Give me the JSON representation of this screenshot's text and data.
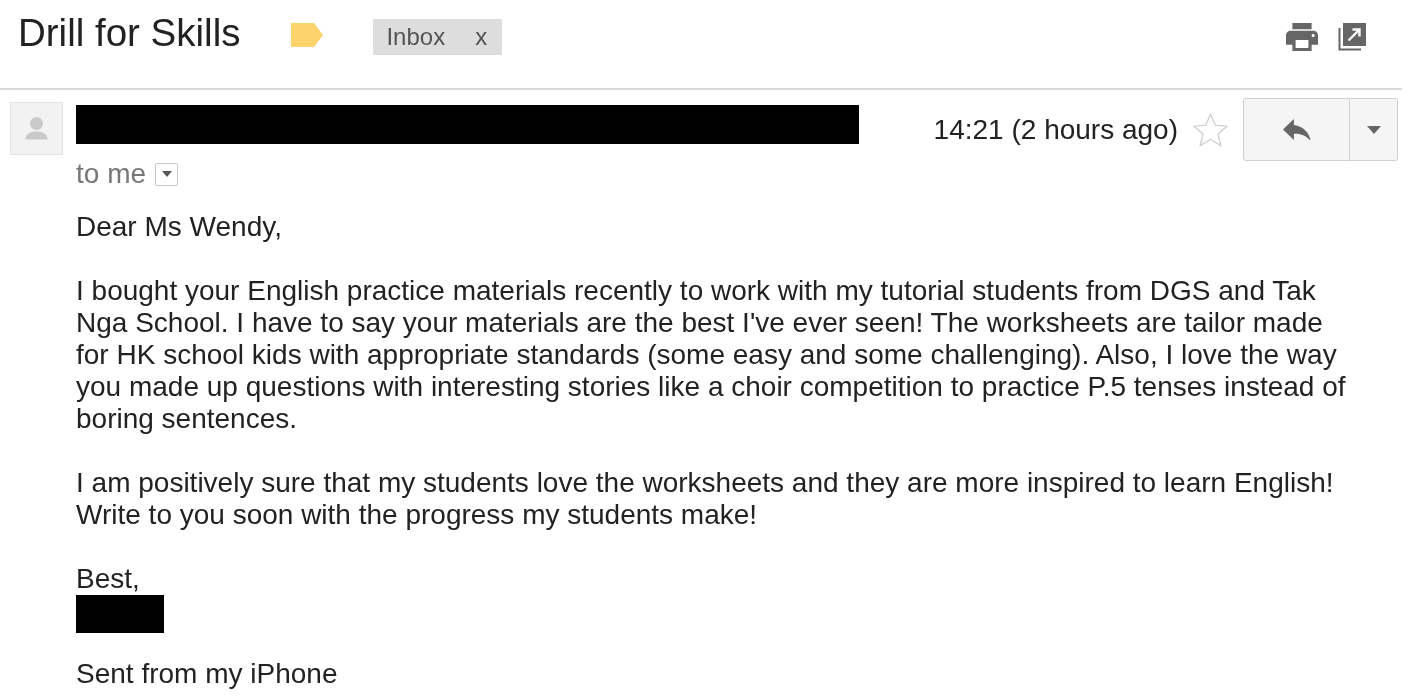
{
  "thread": {
    "subject": "Drill for Skills",
    "important": true,
    "labels": [
      {
        "name": "Inbox",
        "remove": "x"
      }
    ]
  },
  "message": {
    "time": "14:21 (2 hours ago)",
    "starred": false,
    "recipient": "to me",
    "greeting": "Dear Ms Wendy,",
    "paragraphs": [
      "I bought your English practice materials recently to work with my tutorial students from DGS and Tak Nga School. I have to say your materials are the best I've ever seen! The worksheets are tailor made for HK school kids with appropriate standards (some easy and some challenging). Also, I love the way you made up questions with interesting stories like a choir competition to practice P.5 tenses instead of boring sentences.",
      "I am positively sure that my students love the worksheets and they are more inspired to learn English! Write to you soon with the progress my students make!"
    ],
    "signoff": "Best,",
    "signature": "Sent from my iPhone"
  }
}
